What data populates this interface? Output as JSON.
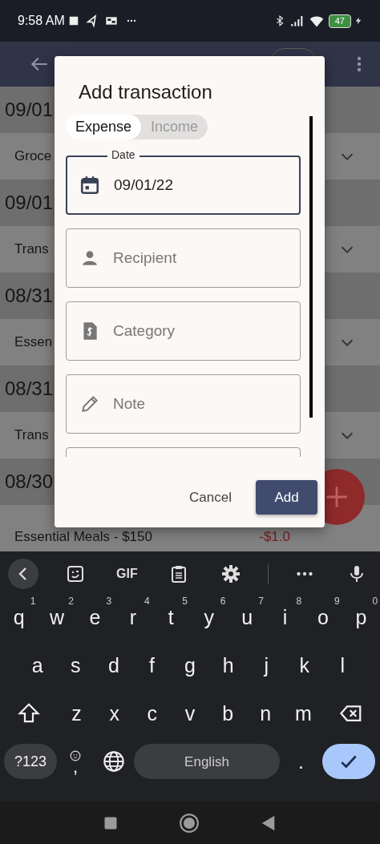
{
  "status_bar": {
    "time": "9:58 AM",
    "battery": "47"
  },
  "list": [
    {
      "kind": "date",
      "text": "09/01"
    },
    {
      "kind": "item",
      "text": "Groce"
    },
    {
      "kind": "date",
      "text": "09/01"
    },
    {
      "kind": "item",
      "text": "Trans"
    },
    {
      "kind": "date",
      "text": "08/31"
    },
    {
      "kind": "item",
      "text": "Essen"
    },
    {
      "kind": "date",
      "text": "08/31"
    },
    {
      "kind": "item",
      "text": "Trans"
    },
    {
      "kind": "date",
      "text": "08/30"
    },
    {
      "kind": "item",
      "text": "Essential Meals - $150",
      "amount": "-$1.0"
    }
  ],
  "dialog": {
    "title": "Add transaction",
    "segments": [
      {
        "label": "Expense",
        "selected": true
      },
      {
        "label": "Income",
        "selected": false
      }
    ],
    "fields": [
      {
        "label": "Date",
        "value": "09/01/22",
        "focused": true
      },
      {
        "placeholder": "Recipient",
        "focused": false
      },
      {
        "placeholder": "Category",
        "focused": false
      },
      {
        "placeholder": "Note",
        "focused": false
      },
      {
        "focused": false
      }
    ],
    "actions": [
      {
        "kind": "text",
        "label": "Cancel"
      },
      {
        "kind": "filled",
        "label": "Add"
      }
    ]
  },
  "keyboard": {
    "toolbar": [
      {
        "kind": "back"
      },
      {
        "kind": "sticker"
      },
      {
        "kind": "gif",
        "label": "GIF"
      },
      {
        "kind": "clipboard"
      },
      {
        "kind": "settings"
      },
      {
        "kind": "divider"
      },
      {
        "kind": "more"
      },
      {
        "kind": "mic"
      }
    ],
    "rows": [
      [
        {
          "kind": "key",
          "label": "q",
          "hint": "1"
        },
        {
          "kind": "key",
          "label": "w",
          "hint": "2"
        },
        {
          "kind": "key",
          "label": "e",
          "hint": "3"
        },
        {
          "kind": "key",
          "label": "r",
          "hint": "4"
        },
        {
          "kind": "key",
          "label": "t",
          "hint": "5"
        },
        {
          "kind": "key",
          "label": "y",
          "hint": "6"
        },
        {
          "kind": "key",
          "label": "u",
          "hint": "7"
        },
        {
          "kind": "key",
          "label": "i",
          "hint": "8"
        },
        {
          "kind": "key",
          "label": "o",
          "hint": "9"
        },
        {
          "kind": "key",
          "label": "p",
          "hint": "0"
        }
      ],
      [
        {
          "kind": "key",
          "label": "a"
        },
        {
          "kind": "key",
          "label": "s"
        },
        {
          "kind": "key",
          "label": "d"
        },
        {
          "kind": "key",
          "label": "f"
        },
        {
          "kind": "key",
          "label": "g"
        },
        {
          "kind": "key",
          "label": "h"
        },
        {
          "kind": "key",
          "label": "j"
        },
        {
          "kind": "key",
          "label": "k"
        },
        {
          "kind": "key",
          "label": "l"
        }
      ],
      [
        {
          "kind": "shift"
        },
        {
          "kind": "key",
          "label": "z"
        },
        {
          "kind": "key",
          "label": "x"
        },
        {
          "kind": "key",
          "label": "c"
        },
        {
          "kind": "key",
          "label": "v"
        },
        {
          "kind": "key",
          "label": "b"
        },
        {
          "kind": "key",
          "label": "n"
        },
        {
          "kind": "key",
          "label": "m"
        },
        {
          "kind": "backspace"
        }
      ]
    ],
    "bottom_bar": {
      "symbols": "?123",
      "comma": ",",
      "space": "English",
      "period": "."
    }
  }
}
